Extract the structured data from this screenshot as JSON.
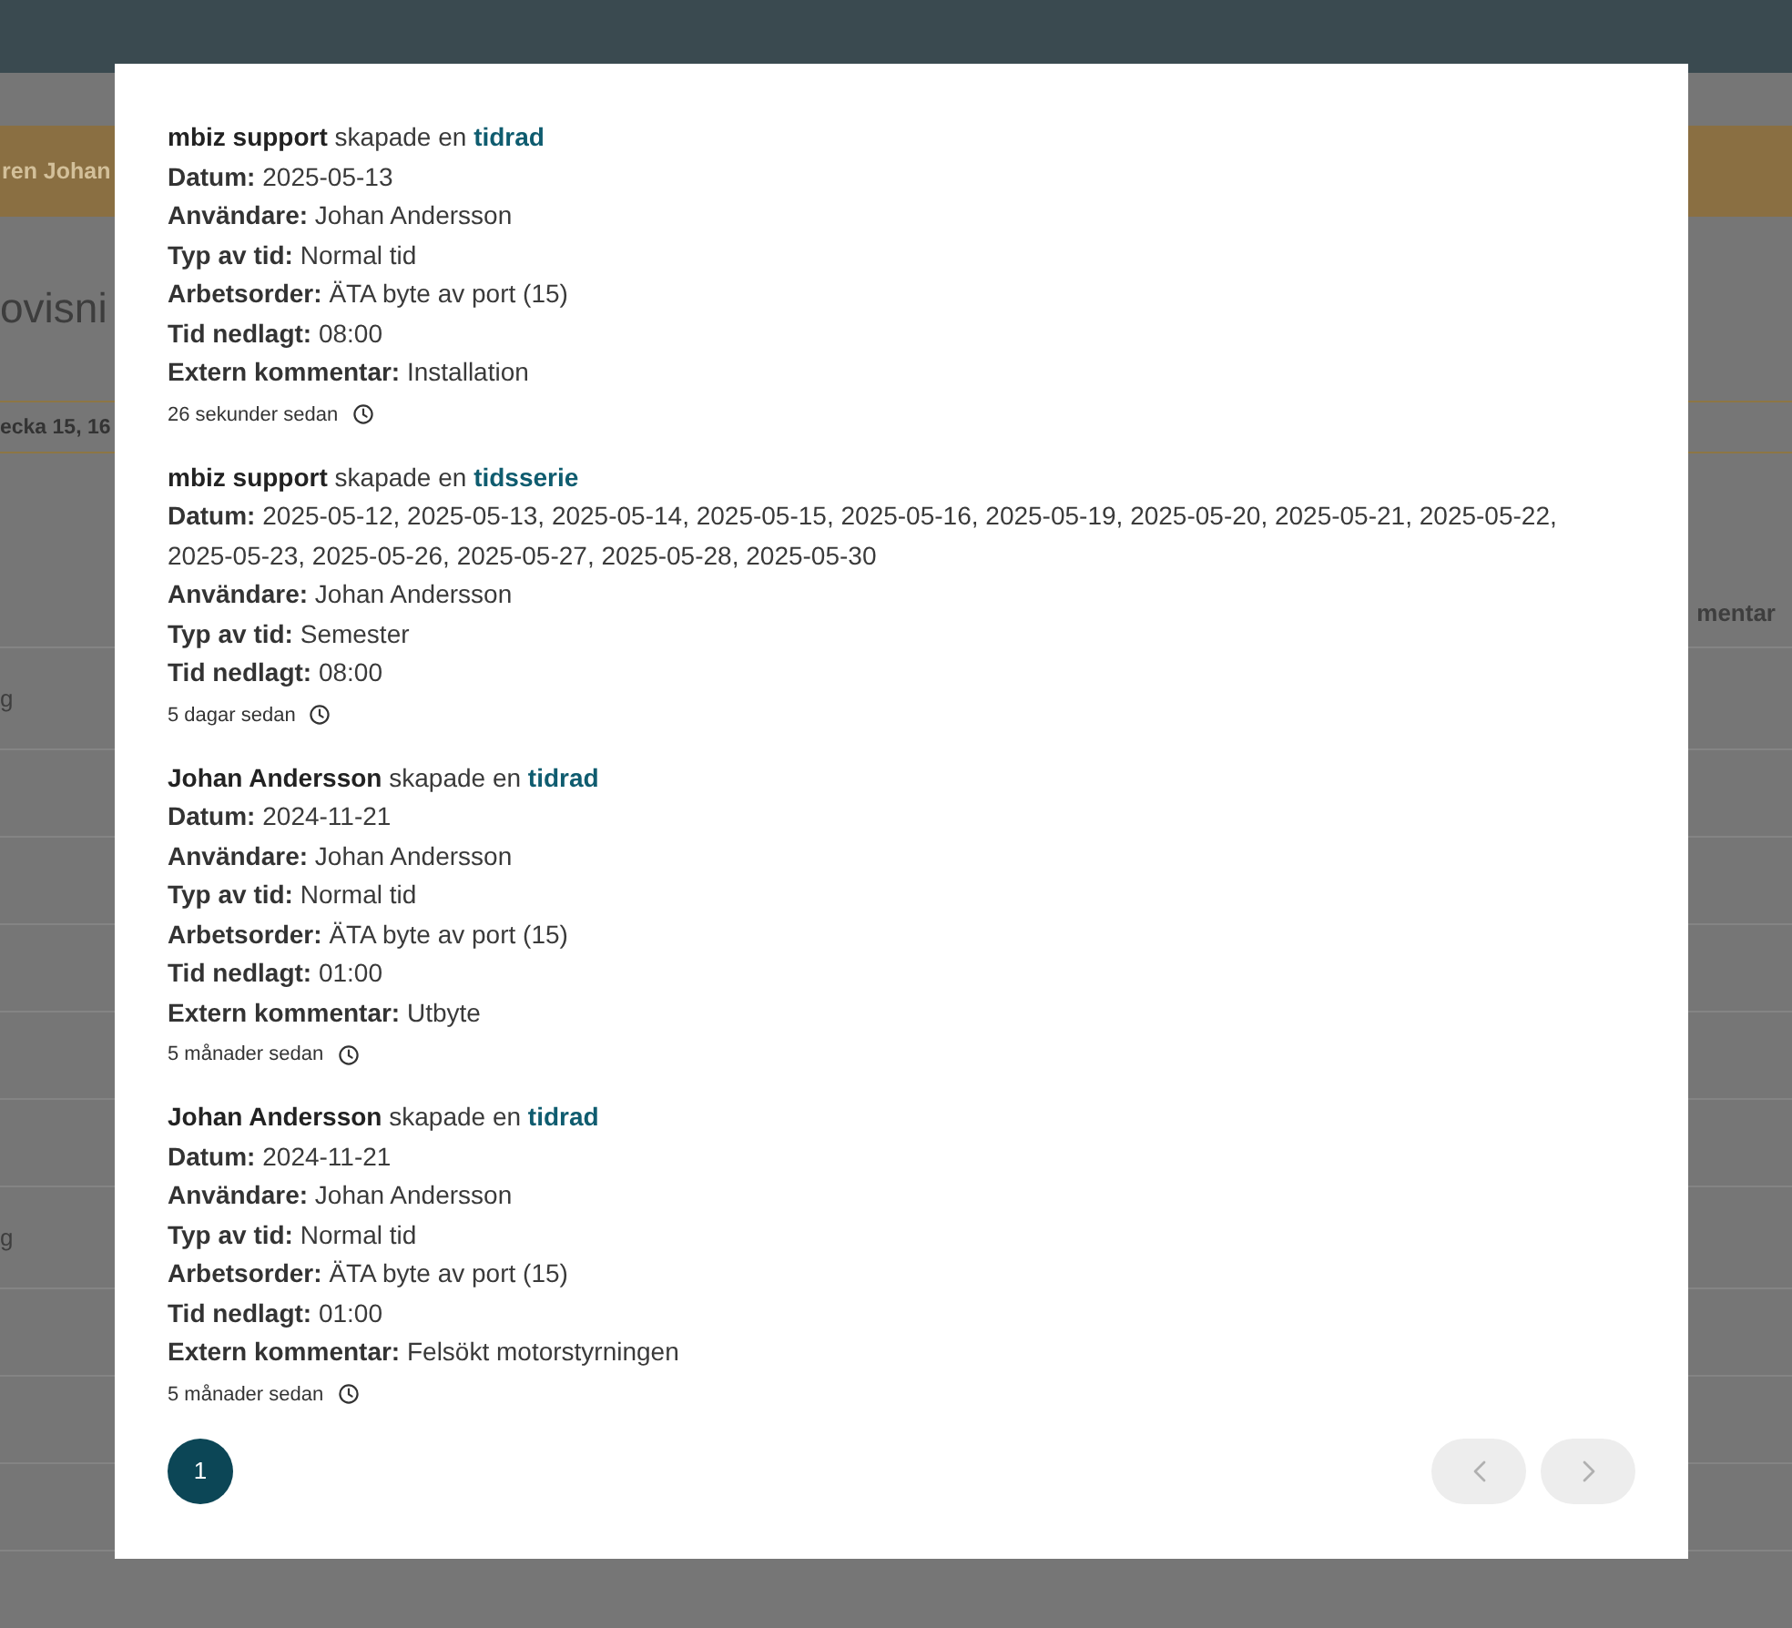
{
  "background_page": {
    "banner": {
      "text": "ren Johan"
    },
    "heading": "ovisni",
    "week_selector": {
      "value": "ecka 15, 16"
    },
    "table": {
      "columns": [
        {
          "label": "mentar"
        }
      ],
      "rows": [
        {
          "column_1": "g"
        },
        {},
        {},
        {},
        {},
        {},
        {
          "column_1": "g"
        },
        {},
        {},
        {}
      ]
    }
  },
  "modal": {
    "entries": [
      {
        "author": "mbiz support",
        "action": "skapade en",
        "object": "tidrad",
        "fields": [
          {
            "label": "Datum:",
            "value": "2025-05-13"
          },
          {
            "label": "Användare:",
            "value": "Johan Andersson"
          },
          {
            "label": "Typ av tid:",
            "value": "Normal tid"
          },
          {
            "label": "Arbetsorder:",
            "value": "ÄTA byte av port (15)"
          },
          {
            "label": "Tid nedlagt:",
            "value": "08:00"
          },
          {
            "label": "Extern kommentar:",
            "value": "Installation"
          }
        ],
        "time": "26 sekunder sedan"
      },
      {
        "author": "mbiz support",
        "action": "skapade en",
        "object": "tidsserie",
        "fields": [
          {
            "label": "Datum:",
            "value": "2025-05-12, 2025-05-13, 2025-05-14, 2025-05-15, 2025-05-16, 2025-05-19, 2025-05-20, 2025-05-21, 2025-05-22, 2025-05-23, 2025-05-26, 2025-05-27, 2025-05-28, 2025-05-30"
          },
          {
            "label": "Användare:",
            "value": "Johan Andersson"
          },
          {
            "label": "Typ av tid:",
            "value": "Semester"
          },
          {
            "label": "Tid nedlagt:",
            "value": "08:00"
          }
        ],
        "time": "5 dagar sedan"
      },
      {
        "author": "Johan Andersson",
        "action": "skapade en",
        "object": "tidrad",
        "fields": [
          {
            "label": "Datum:",
            "value": "2024-11-21"
          },
          {
            "label": "Användare:",
            "value": "Johan Andersson"
          },
          {
            "label": "Typ av tid:",
            "value": "Normal tid"
          },
          {
            "label": "Arbetsorder:",
            "value": "ÄTA byte av port (15)"
          },
          {
            "label": "Tid nedlagt:",
            "value": "01:00"
          },
          {
            "label": "Extern kommentar:",
            "value": "Utbyte"
          }
        ],
        "time": "5 månader sedan"
      },
      {
        "author": "Johan Andersson",
        "action": "skapade en",
        "object": "tidrad",
        "fields": [
          {
            "label": "Datum:",
            "value": "2024-11-21"
          },
          {
            "label": "Användare:",
            "value": "Johan Andersson"
          },
          {
            "label": "Typ av tid:",
            "value": "Normal tid"
          },
          {
            "label": "Arbetsorder:",
            "value": "ÄTA byte av port (15)"
          },
          {
            "label": "Tid nedlagt:",
            "value": "01:00"
          },
          {
            "label": "Extern kommentar:",
            "value": "Felsökt motorstyrningen"
          }
        ],
        "time": "5 månader sedan"
      }
    ],
    "pagination": {
      "pages": [
        {
          "label": "1",
          "selected": true
        }
      ],
      "previous": {
        "disabled": true
      },
      "next": {
        "disabled": true
      }
    }
  }
}
